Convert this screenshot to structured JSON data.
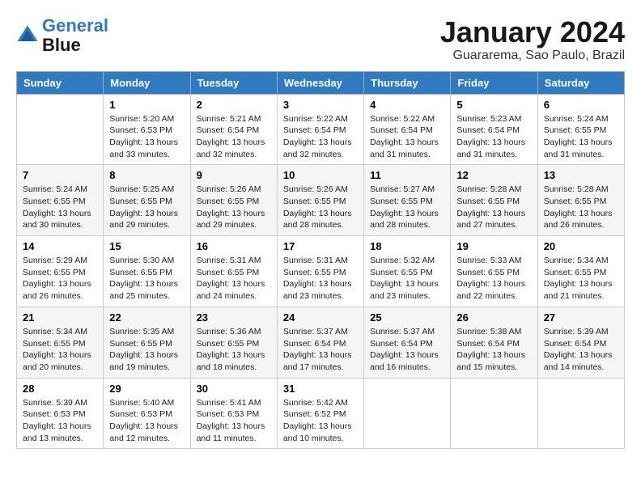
{
  "header": {
    "logo_line1": "General",
    "logo_line2": "Blue",
    "month": "January 2024",
    "location": "Guararema, Sao Paulo, Brazil"
  },
  "weekdays": [
    "Sunday",
    "Monday",
    "Tuesday",
    "Wednesday",
    "Thursday",
    "Friday",
    "Saturday"
  ],
  "weeks": [
    [
      {
        "day": "",
        "info": ""
      },
      {
        "day": "1",
        "info": "Sunrise: 5:20 AM\nSunset: 6:53 PM\nDaylight: 13 hours\nand 33 minutes."
      },
      {
        "day": "2",
        "info": "Sunrise: 5:21 AM\nSunset: 6:54 PM\nDaylight: 13 hours\nand 32 minutes."
      },
      {
        "day": "3",
        "info": "Sunrise: 5:22 AM\nSunset: 6:54 PM\nDaylight: 13 hours\nand 32 minutes."
      },
      {
        "day": "4",
        "info": "Sunrise: 5:22 AM\nSunset: 6:54 PM\nDaylight: 13 hours\nand 31 minutes."
      },
      {
        "day": "5",
        "info": "Sunrise: 5:23 AM\nSunset: 6:54 PM\nDaylight: 13 hours\nand 31 minutes."
      },
      {
        "day": "6",
        "info": "Sunrise: 5:24 AM\nSunset: 6:55 PM\nDaylight: 13 hours\nand 31 minutes."
      }
    ],
    [
      {
        "day": "7",
        "info": "Sunrise: 5:24 AM\nSunset: 6:55 PM\nDaylight: 13 hours\nand 30 minutes."
      },
      {
        "day": "8",
        "info": "Sunrise: 5:25 AM\nSunset: 6:55 PM\nDaylight: 13 hours\nand 29 minutes."
      },
      {
        "day": "9",
        "info": "Sunrise: 5:26 AM\nSunset: 6:55 PM\nDaylight: 13 hours\nand 29 minutes."
      },
      {
        "day": "10",
        "info": "Sunrise: 5:26 AM\nSunset: 6:55 PM\nDaylight: 13 hours\nand 28 minutes."
      },
      {
        "day": "11",
        "info": "Sunrise: 5:27 AM\nSunset: 6:55 PM\nDaylight: 13 hours\nand 28 minutes."
      },
      {
        "day": "12",
        "info": "Sunrise: 5:28 AM\nSunset: 6:55 PM\nDaylight: 13 hours\nand 27 minutes."
      },
      {
        "day": "13",
        "info": "Sunrise: 5:28 AM\nSunset: 6:55 PM\nDaylight: 13 hours\nand 26 minutes."
      }
    ],
    [
      {
        "day": "14",
        "info": "Sunrise: 5:29 AM\nSunset: 6:55 PM\nDaylight: 13 hours\nand 26 minutes."
      },
      {
        "day": "15",
        "info": "Sunrise: 5:30 AM\nSunset: 6:55 PM\nDaylight: 13 hours\nand 25 minutes."
      },
      {
        "day": "16",
        "info": "Sunrise: 5:31 AM\nSunset: 6:55 PM\nDaylight: 13 hours\nand 24 minutes."
      },
      {
        "day": "17",
        "info": "Sunrise: 5:31 AM\nSunset: 6:55 PM\nDaylight: 13 hours\nand 23 minutes."
      },
      {
        "day": "18",
        "info": "Sunrise: 5:32 AM\nSunset: 6:55 PM\nDaylight: 13 hours\nand 23 minutes."
      },
      {
        "day": "19",
        "info": "Sunrise: 5:33 AM\nSunset: 6:55 PM\nDaylight: 13 hours\nand 22 minutes."
      },
      {
        "day": "20",
        "info": "Sunrise: 5:34 AM\nSunset: 6:55 PM\nDaylight: 13 hours\nand 21 minutes."
      }
    ],
    [
      {
        "day": "21",
        "info": "Sunrise: 5:34 AM\nSunset: 6:55 PM\nDaylight: 13 hours\nand 20 minutes."
      },
      {
        "day": "22",
        "info": "Sunrise: 5:35 AM\nSunset: 6:55 PM\nDaylight: 13 hours\nand 19 minutes."
      },
      {
        "day": "23",
        "info": "Sunrise: 5:36 AM\nSunset: 6:55 PM\nDaylight: 13 hours\nand 18 minutes."
      },
      {
        "day": "24",
        "info": "Sunrise: 5:37 AM\nSunset: 6:54 PM\nDaylight: 13 hours\nand 17 minutes."
      },
      {
        "day": "25",
        "info": "Sunrise: 5:37 AM\nSunset: 6:54 PM\nDaylight: 13 hours\nand 16 minutes."
      },
      {
        "day": "26",
        "info": "Sunrise: 5:38 AM\nSunset: 6:54 PM\nDaylight: 13 hours\nand 15 minutes."
      },
      {
        "day": "27",
        "info": "Sunrise: 5:39 AM\nSunset: 6:54 PM\nDaylight: 13 hours\nand 14 minutes."
      }
    ],
    [
      {
        "day": "28",
        "info": "Sunrise: 5:39 AM\nSunset: 6:53 PM\nDaylight: 13 hours\nand 13 minutes."
      },
      {
        "day": "29",
        "info": "Sunrise: 5:40 AM\nSunset: 6:53 PM\nDaylight: 13 hours\nand 12 minutes."
      },
      {
        "day": "30",
        "info": "Sunrise: 5:41 AM\nSunset: 6:53 PM\nDaylight: 13 hours\nand 11 minutes."
      },
      {
        "day": "31",
        "info": "Sunrise: 5:42 AM\nSunset: 6:52 PM\nDaylight: 13 hours\nand 10 minutes."
      },
      {
        "day": "",
        "info": ""
      },
      {
        "day": "",
        "info": ""
      },
      {
        "day": "",
        "info": ""
      }
    ]
  ]
}
